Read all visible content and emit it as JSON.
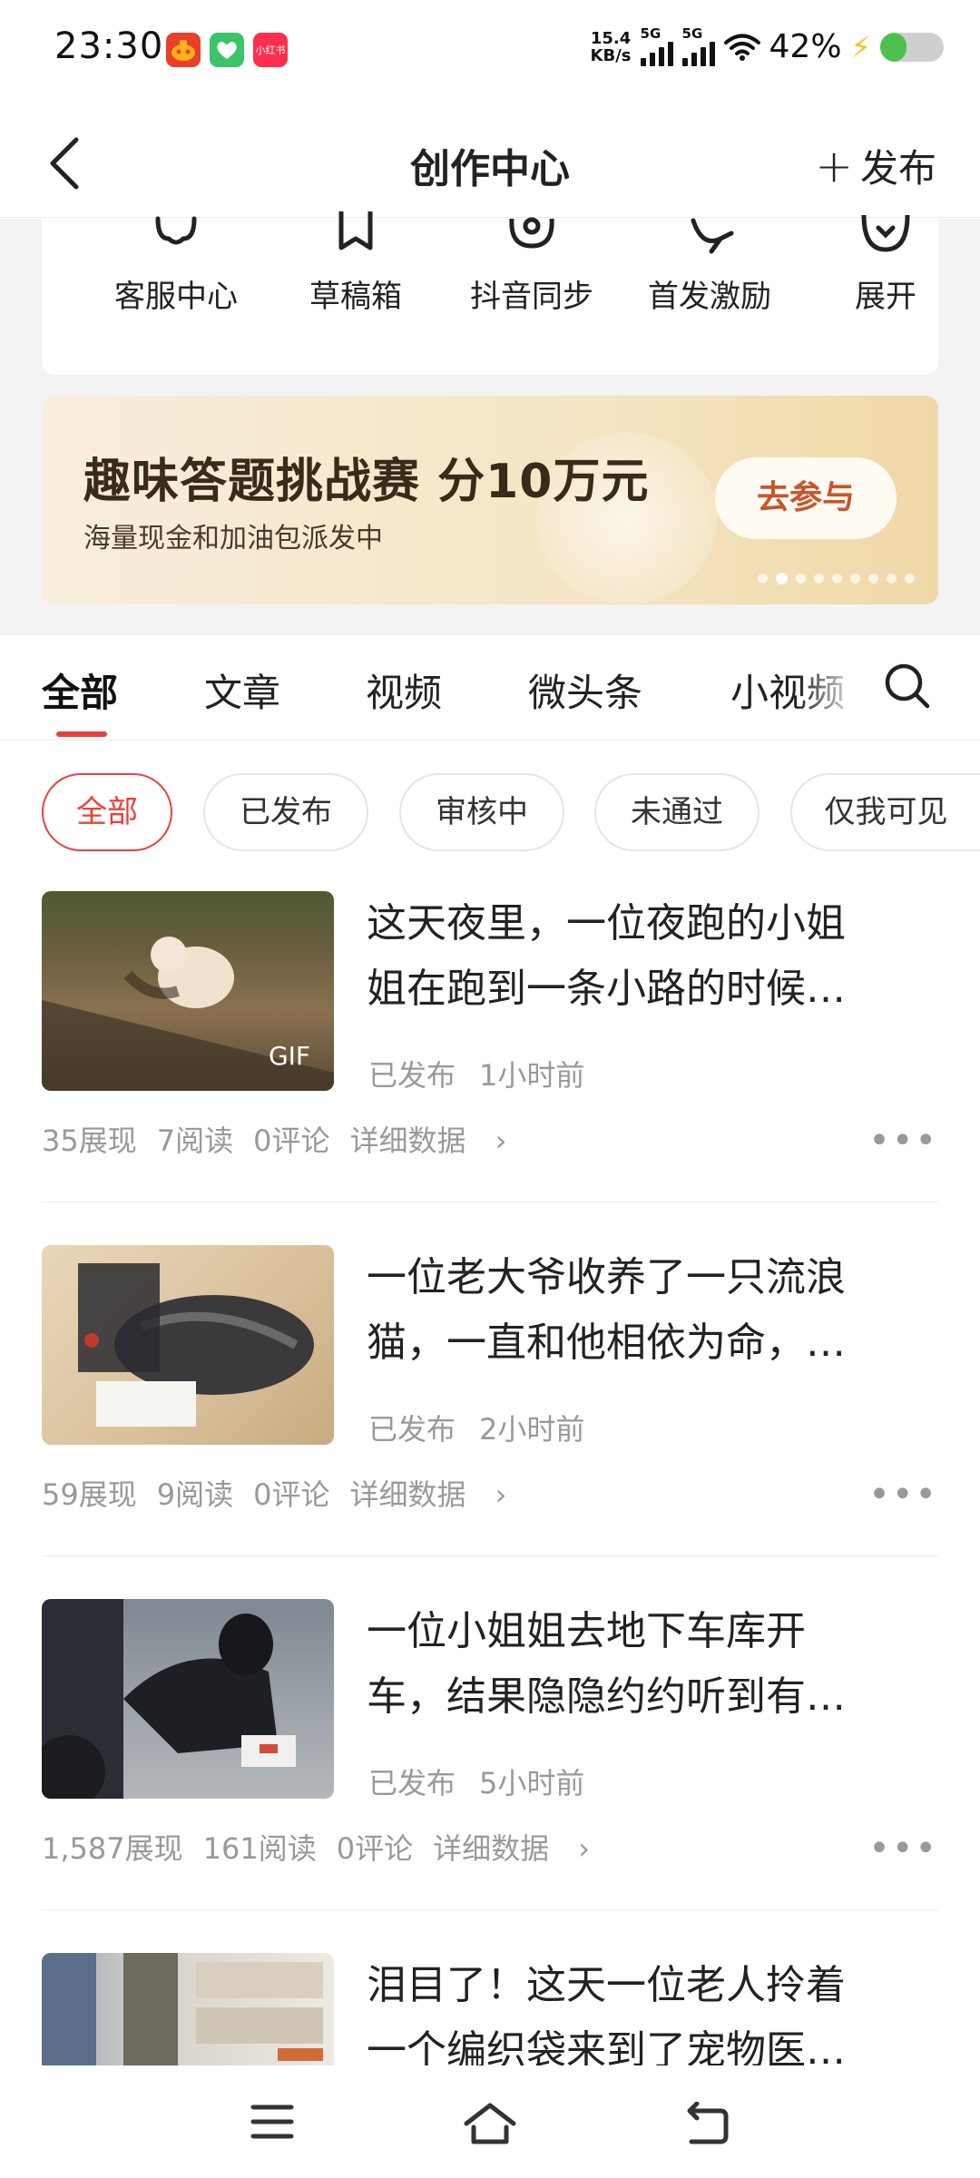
{
  "status_bar": {
    "time": "23:30",
    "app_icons": [
      {
        "name": "app-icon-red",
        "color": "#e8402a",
        "text": ""
      },
      {
        "name": "app-icon-green",
        "color": "#3ac569",
        "text": ""
      },
      {
        "name": "app-icon-pink",
        "color": "#ff2e4d",
        "text": "小红书"
      }
    ],
    "net_speed_value": "15.4",
    "net_speed_unit": "KB/s",
    "signal_1_label": "5G",
    "signal_2_label": "5G",
    "battery_text": "42%",
    "battery_level": 0.42
  },
  "nav": {
    "title": "创作中心",
    "publish_label": "发布"
  },
  "tools": [
    {
      "label": "客服中心",
      "icon": "headset-icon"
    },
    {
      "label": "草稿箱",
      "icon": "draft-icon"
    },
    {
      "label": "抖音同步",
      "icon": "sync-icon"
    },
    {
      "label": "首发激励",
      "icon": "incentive-icon"
    },
    {
      "label": "展开",
      "icon": "expand-icon"
    }
  ],
  "banner": {
    "title": "趣味答题挑战赛 分10万元",
    "subtitle": "海量现金和加油包派发中",
    "button": "去参与",
    "dot_count": 9,
    "active_dot": 1
  },
  "tabs": [
    {
      "label": "全部",
      "active": true
    },
    {
      "label": "文章",
      "active": false
    },
    {
      "label": "视频",
      "active": false
    },
    {
      "label": "微头条",
      "active": false
    },
    {
      "label": "小视频",
      "active": false
    }
  ],
  "filters": [
    {
      "label": "全部",
      "active": true
    },
    {
      "label": "已发布",
      "active": false
    },
    {
      "label": "审核中",
      "active": false
    },
    {
      "label": "未通过",
      "active": false
    },
    {
      "label": "仅我可见",
      "active": false
    }
  ],
  "articles": [
    {
      "title_line1": "这天夜里，一位夜跑的小姐",
      "title_line2": "姐在跑到一条小路的时候…",
      "thumb_tag": "GIF",
      "status": "已发布",
      "time": "1小时前",
      "impressions": "35展现",
      "reads": "7阅读",
      "comments": "0评论",
      "details": "详细数据"
    },
    {
      "title_line1": "一位老大爷收养了一只流浪",
      "title_line2": "猫，一直和他相依为命，…",
      "thumb_tag": "",
      "status": "已发布",
      "time": "2小时前",
      "impressions": "59展现",
      "reads": "9阅读",
      "comments": "0评论",
      "details": "详细数据"
    },
    {
      "title_line1": "一位小姐姐去地下车库开",
      "title_line2": "车，结果隐隐约约听到有…",
      "thumb_tag": "",
      "status": "已发布",
      "time": "5小时前",
      "impressions": "1,587展现",
      "reads": "161阅读",
      "comments": "0评论",
      "details": "详细数据"
    },
    {
      "title_line1": "泪目了！这天一位老人拎着",
      "title_line2": "一个编织袋来到了宠物医…",
      "thumb_tag": "",
      "status": "",
      "time": "",
      "impressions": "",
      "reads": "",
      "comments": "",
      "details": ""
    }
  ],
  "colors": {
    "accent": "#e8413b",
    "banner_button_text": "#c8552d",
    "meta_gray": "#999999"
  }
}
